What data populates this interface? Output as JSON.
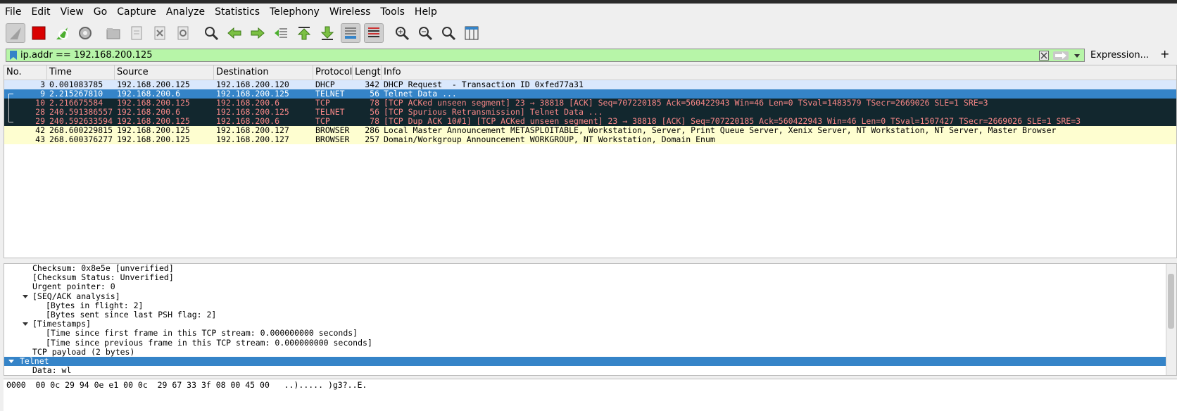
{
  "menu": [
    "File",
    "Edit",
    "View",
    "Go",
    "Capture",
    "Analyze",
    "Statistics",
    "Telephony",
    "Wireless",
    "Tools",
    "Help"
  ],
  "toolbar_icons": [
    "shark-fin-start-icon",
    "stop-capture-icon",
    "restart-capture-icon",
    "capture-options-icon",
    "open-file-icon",
    "save-file-icon",
    "close-file-icon",
    "reload-file-icon",
    "find-packet-icon",
    "go-back-icon",
    "go-forward-icon",
    "go-to-packet-icon",
    "go-first-icon",
    "go-last-icon",
    "autoscroll-icon",
    "colorize-icon",
    "zoom-in-icon",
    "zoom-out-icon",
    "zoom-normal-icon",
    "resize-columns-icon"
  ],
  "filter": {
    "value": "ip.addr == 192.168.200.125",
    "expression_label": "Expression...",
    "plus_label": "+"
  },
  "columns": {
    "no": "No.",
    "time": "Time",
    "source": "Source",
    "destination": "Destination",
    "protocol": "Protocol",
    "length": "Length",
    "info": "Info"
  },
  "packets": [
    {
      "no": "3",
      "time": "0.001083785",
      "src": "192.168.200.125",
      "dst": "192.168.200.120",
      "proto": "DHCP",
      "len": "342",
      "info": "DHCP Request  - Transaction ID 0xfed77a31"
    },
    {
      "no": "9",
      "time": "2.215267810",
      "src": "192.168.200.6",
      "dst": "192.168.200.125",
      "proto": "TELNET",
      "len": "56",
      "info": "Telnet Data ..."
    },
    {
      "no": "10",
      "time": "2.216675584",
      "src": "192.168.200.125",
      "dst": "192.168.200.6",
      "proto": "TCP",
      "len": "78",
      "info": "[TCP ACKed unseen segment] 23 → 38818 [ACK] Seq=707220185 Ack=560422943 Win=46 Len=0 TSval=1483579 TSecr=2669026 SLE=1 SRE=3"
    },
    {
      "no": "28",
      "time": "240.591386557",
      "src": "192.168.200.6",
      "dst": "192.168.200.125",
      "proto": "TELNET",
      "len": "56",
      "info": "[TCP Spurious Retransmission] Telnet Data ..."
    },
    {
      "no": "29",
      "time": "240.592633594",
      "src": "192.168.200.125",
      "dst": "192.168.200.6",
      "proto": "TCP",
      "len": "78",
      "info": "[TCP Dup ACK 10#1] [TCP ACKed unseen segment] 23 → 38818 [ACK] Seq=707220185 Ack=560422943 Win=46 Len=0 TSval=1507427 TSecr=2669026 SLE=1 SRE=3"
    },
    {
      "no": "42",
      "time": "268.600229815",
      "src": "192.168.200.125",
      "dst": "192.168.200.127",
      "proto": "BROWSER",
      "len": "286",
      "info": "Local Master Announcement METASPLOITABLE, Workstation, Server, Print Queue Server, Xenix Server, NT Workstation, NT Server, Master Browser"
    },
    {
      "no": "43",
      "time": "268.600376277",
      "src": "192.168.200.125",
      "dst": "192.168.200.127",
      "proto": "BROWSER",
      "len": "257",
      "info": "Domain/Workgroup Announcement WORKGROUP, NT Workstation, Domain Enum"
    }
  ],
  "details": [
    {
      "text": "Checksum: 0x8e5e [unverified]"
    },
    {
      "text": "[Checksum Status: Unverified]"
    },
    {
      "text": "Urgent pointer: 0"
    },
    {
      "text": "[SEQ/ACK analysis]"
    },
    {
      "text": "[Bytes in flight: 2]"
    },
    {
      "text": "[Bytes sent since last PSH flag: 2]"
    },
    {
      "text": "[Timestamps]"
    },
    {
      "text": "[Time since first frame in this TCP stream: 0.000000000 seconds]"
    },
    {
      "text": "[Time since previous frame in this TCP stream: 0.000000000 seconds]"
    },
    {
      "text": "TCP payload (2 bytes)"
    },
    {
      "text": "Telnet"
    },
    {
      "text": "Data: wl"
    }
  ],
  "bytes_line": "0000  00 0c 29 94 0e e1 00 0c  29 67 33 3f 08 00 45 00   ..)..... )g3?..E."
}
